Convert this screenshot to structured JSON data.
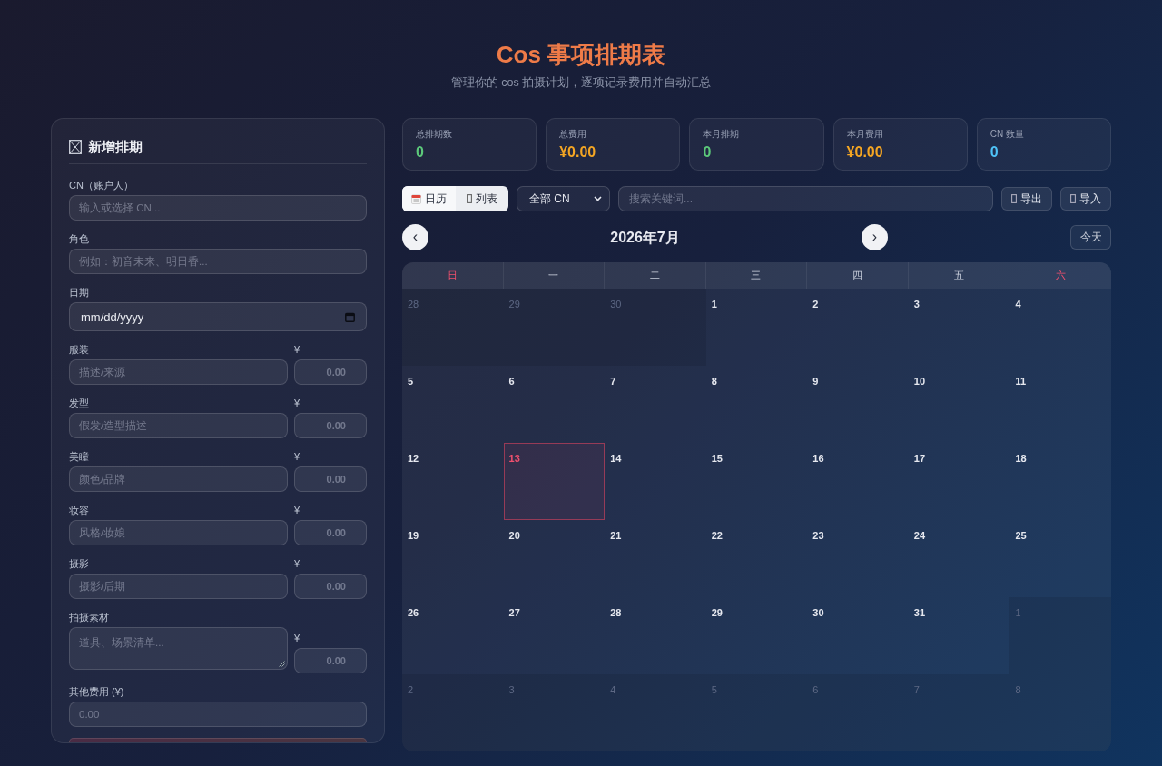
{
  "header": {
    "title": "Cos 事项排期表",
    "subtitle": "管理你的 cos 拍摄计划，逐项记录费用并自动汇总"
  },
  "form": {
    "title": "新增排期",
    "fields": [
      {
        "kind": "text",
        "label": "CN（账户人）",
        "placeholder": "输入或选择 CN..."
      },
      {
        "kind": "text",
        "label": "角色",
        "placeholder": "例如：初音未来、明日香..."
      },
      {
        "kind": "date",
        "label": "日期",
        "placeholder": "mm/dd/yyyy"
      },
      {
        "kind": "cost",
        "label": "服装",
        "placeholder": "描述/来源",
        "cost_label": "¥",
        "cost_placeholder": "0.00"
      },
      {
        "kind": "cost",
        "label": "发型",
        "placeholder": "假发/造型描述",
        "cost_label": "¥",
        "cost_placeholder": "0.00"
      },
      {
        "kind": "cost",
        "label": "美瞳",
        "placeholder": "颜色/品牌",
        "cost_label": "¥",
        "cost_placeholder": "0.00"
      },
      {
        "kind": "cost",
        "label": "妆容",
        "placeholder": "风格/妆娘",
        "cost_label": "¥",
        "cost_placeholder": "0.00"
      },
      {
        "kind": "cost",
        "label": "摄影",
        "placeholder": "摄影/后期",
        "cost_label": "¥",
        "cost_placeholder": "0.00"
      },
      {
        "kind": "textarea_cost",
        "label": "拍摄素材",
        "placeholder": "道具、场景清单...",
        "cost_label": "¥",
        "cost_placeholder": "0.00"
      },
      {
        "kind": "number",
        "label": "其他费用 (¥)",
        "placeholder": "0.00"
      }
    ]
  },
  "stats": [
    {
      "label": "总排期数",
      "value": "0",
      "color": "#5cc97a"
    },
    {
      "label": "总费用",
      "value": "¥0.00",
      "color": "#f5a623"
    },
    {
      "label": "本月排期",
      "value": "0",
      "color": "#5cc97a"
    },
    {
      "label": "本月费用",
      "value": "¥0.00",
      "color": "#f5a623"
    },
    {
      "label": "CN 数量",
      "value": "0",
      "color": "#4fc3f7"
    }
  ],
  "toolbar": {
    "views": [
      {
        "kind": "calendar",
        "label": "日历",
        "selected": true
      },
      {
        "kind": "list",
        "label": "列表",
        "selected": false
      }
    ],
    "cn_filter": {
      "value": "全部 CN"
    },
    "search": {
      "placeholder": "搜索关键词..."
    },
    "actions": [
      {
        "label": "导出"
      },
      {
        "label": "导入"
      }
    ]
  },
  "calendar": {
    "prev": "‹",
    "title": "2026年7月",
    "next": "›",
    "today_button": "今天",
    "weekdays": [
      {
        "label": "日",
        "weekend": true
      },
      {
        "label": "一",
        "weekend": false
      },
      {
        "label": "二",
        "weekend": false
      },
      {
        "label": "三",
        "weekend": false
      },
      {
        "label": "四",
        "weekend": false
      },
      {
        "label": "五",
        "weekend": false
      },
      {
        "label": "六",
        "weekend": true
      }
    ],
    "days": [
      {
        "label": "28",
        "in_month": false,
        "today": false
      },
      {
        "label": "29",
        "in_month": false,
        "today": false
      },
      {
        "label": "30",
        "in_month": false,
        "today": false
      },
      {
        "label": "1",
        "in_month": true,
        "today": false
      },
      {
        "label": "2",
        "in_month": true,
        "today": false
      },
      {
        "label": "3",
        "in_month": true,
        "today": false
      },
      {
        "label": "4",
        "in_month": true,
        "today": false
      },
      {
        "label": "5",
        "in_month": true,
        "today": false
      },
      {
        "label": "6",
        "in_month": true,
        "today": false
      },
      {
        "label": "7",
        "in_month": true,
        "today": false
      },
      {
        "label": "8",
        "in_month": true,
        "today": false
      },
      {
        "label": "9",
        "in_month": true,
        "today": false
      },
      {
        "label": "10",
        "in_month": true,
        "today": false
      },
      {
        "label": "11",
        "in_month": true,
        "today": false
      },
      {
        "label": "12",
        "in_month": true,
        "today": false
      },
      {
        "label": "13",
        "in_month": true,
        "today": true
      },
      {
        "label": "14",
        "in_month": true,
        "today": false
      },
      {
        "label": "15",
        "in_month": true,
        "today": false
      },
      {
        "label": "16",
        "in_month": true,
        "today": false
      },
      {
        "label": "17",
        "in_month": true,
        "today": false
      },
      {
        "label": "18",
        "in_month": true,
        "today": false
      },
      {
        "label": "19",
        "in_month": true,
        "today": false
      },
      {
        "label": "20",
        "in_month": true,
        "today": false
      },
      {
        "label": "21",
        "in_month": true,
        "today": false
      },
      {
        "label": "22",
        "in_month": true,
        "today": false
      },
      {
        "label": "23",
        "in_month": true,
        "today": false
      },
      {
        "label": "24",
        "in_month": true,
        "today": false
      },
      {
        "label": "25",
        "in_month": true,
        "today": false
      },
      {
        "label": "26",
        "in_month": true,
        "today": false
      },
      {
        "label": "27",
        "in_month": true,
        "today": false
      },
      {
        "label": "28",
        "in_month": true,
        "today": false
      },
      {
        "label": "29",
        "in_month": true,
        "today": false
      },
      {
        "label": "30",
        "in_month": true,
        "today": false
      },
      {
        "label": "31",
        "in_month": true,
        "today": false
      },
      {
        "label": "1",
        "in_month": false,
        "today": false
      },
      {
        "label": "2",
        "in_month": false,
        "today": false
      },
      {
        "label": "3",
        "in_month": false,
        "today": false
      },
      {
        "label": "4",
        "in_month": false,
        "today": false
      },
      {
        "label": "5",
        "in_month": false,
        "today": false
      },
      {
        "label": "6",
        "in_month": false,
        "today": false
      },
      {
        "label": "7",
        "in_month": false,
        "today": false
      },
      {
        "label": "8",
        "in_month": false,
        "today": false
      }
    ]
  }
}
